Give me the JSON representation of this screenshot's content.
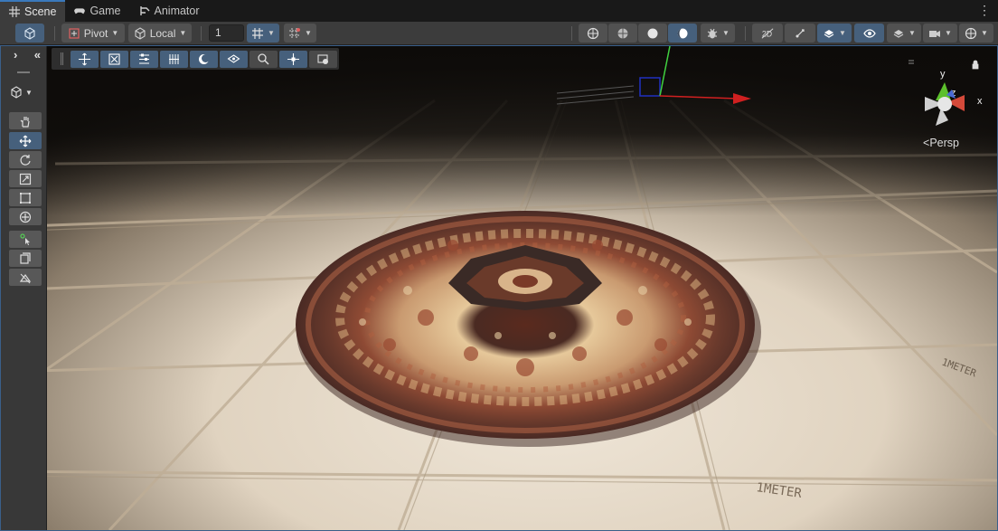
{
  "tabs": [
    {
      "label": "Scene",
      "icon": "grid-icon",
      "active": true
    },
    {
      "label": "Game",
      "icon": "gamepad-icon",
      "active": false
    },
    {
      "label": "Animator",
      "icon": "animator-icon",
      "active": false
    }
  ],
  "toolbar": {
    "pivot_label": "Pivot",
    "space_label": "Local",
    "snap_value": "1"
  },
  "tool_panel": {
    "tools": [
      "hand-tool",
      "move-tool",
      "rotate-tool",
      "scale-tool",
      "rect-tool",
      "transform-tool",
      "custom-tool",
      "component-tool",
      "probe-tool"
    ]
  },
  "gizmo": {
    "x_label": "x",
    "y_label": "y",
    "z_label": "z",
    "projection_label": "Persp"
  },
  "scene": {
    "floor_markings": [
      "1METER",
      "1METER"
    ]
  },
  "colors": {
    "accent": "#46607c",
    "selection_border": "#3a79bb"
  }
}
